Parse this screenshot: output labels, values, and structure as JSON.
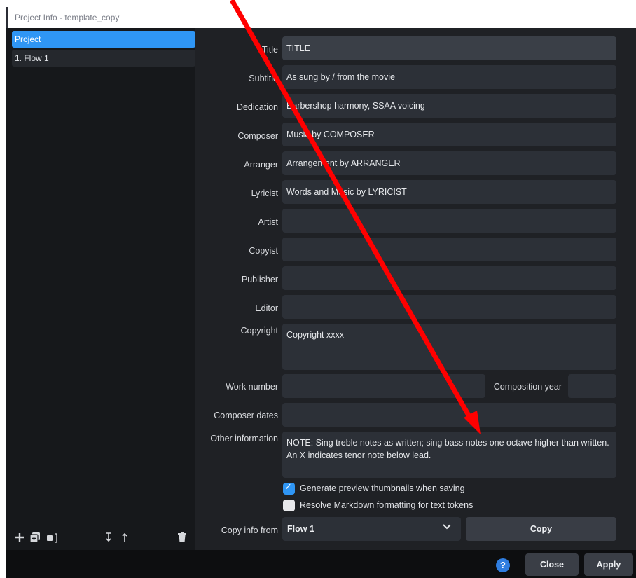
{
  "window": {
    "title": "Project Info - template_copy"
  },
  "sidebar": {
    "items": [
      {
        "label": "Project",
        "selected": true
      },
      {
        "label": "1. Flow 1",
        "selected": false
      }
    ],
    "toolbar_icons": [
      "add-icon",
      "duplicate-icon",
      "split-icon",
      "move-down-icon",
      "move-up-icon",
      "delete-icon"
    ]
  },
  "form": {
    "title": {
      "label": "Title",
      "value": "TITLE"
    },
    "subtitle": {
      "label": "Subtitle",
      "value": "As sung by / from the movie"
    },
    "dedication": {
      "label": "Dedication",
      "value": "Barbershop harmony, SSAA voicing"
    },
    "composer": {
      "label": "Composer",
      "value": "Music by COMPOSER"
    },
    "arranger": {
      "label": "Arranger",
      "value": "Arrangement by ARRANGER"
    },
    "lyricist": {
      "label": "Lyricist",
      "value": "Words and Music by LYRICIST"
    },
    "artist": {
      "label": "Artist",
      "value": ""
    },
    "copyist": {
      "label": "Copyist",
      "value": ""
    },
    "publisher": {
      "label": "Publisher",
      "value": ""
    },
    "editor": {
      "label": "Editor",
      "value": ""
    },
    "copyright": {
      "label": "Copyright",
      "value": "Copyright xxxx"
    },
    "work_number": {
      "label": "Work number",
      "value": ""
    },
    "composition_year": {
      "label": "Composition year",
      "value": ""
    },
    "composer_dates": {
      "label": "Composer dates",
      "value": ""
    },
    "other_information": {
      "label": "Other information",
      "value": "NOTE:  Sing treble notes as written; sing bass notes one octave higher than written. An X indicates tenor note below lead."
    }
  },
  "options": {
    "generate_thumbnails": {
      "label": "Generate preview thumbnails when saving",
      "checked": true
    },
    "resolve_markdown": {
      "label": "Resolve Markdown formatting for text tokens",
      "checked": false
    }
  },
  "copy_info": {
    "label": "Copy info from",
    "selected": "Flow 1",
    "button": "Copy"
  },
  "footer": {
    "help": "?",
    "close": "Close",
    "apply": "Apply"
  },
  "annotation": {
    "color": "#ff0000"
  },
  "colors": {
    "accent": "#2f96f5",
    "panel": "#1f2125",
    "field": "#2c3037"
  }
}
